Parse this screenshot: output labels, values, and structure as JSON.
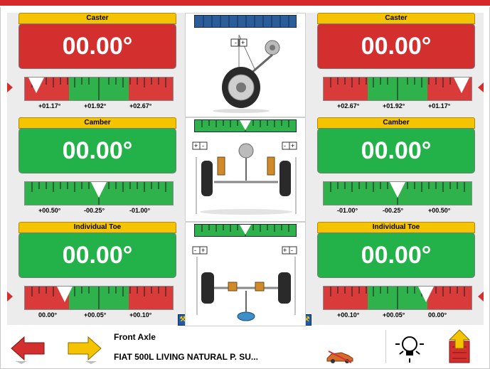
{
  "gauges": {
    "caster_left": {
      "title": "Caster",
      "value": "00.00°",
      "labels": [
        "+01.17°",
        "+01.92°",
        "+02.67°"
      ]
    },
    "caster_right": {
      "title": "Caster",
      "value": "00.00°",
      "labels": [
        "+02.67°",
        "+01.92°",
        "+01.17°"
      ]
    },
    "camber_left": {
      "title": "Camber",
      "value": "00.00°",
      "labels": [
        "+00.50°",
        "-00.25°",
        "-01.00°"
      ]
    },
    "camber_right": {
      "title": "Camber",
      "value": "00.00°",
      "labels": [
        "-01.00°",
        "-00.25°",
        "+00.50°"
      ]
    },
    "toe_left": {
      "title": "Individual Toe",
      "value": "00.00°",
      "labels": [
        "00.00°",
        "+00.05°",
        "+00.10°"
      ]
    },
    "toe_right": {
      "title": "Individual Toe",
      "value": "00.00°",
      "labels": [
        "+00.10°",
        "+00.05°",
        "00.00°"
      ]
    }
  },
  "bottom": {
    "axle": "Front Axle",
    "vehicle": "FIAT 500L LIVING NATURAL P. SU..."
  },
  "colors": {
    "red": "#d42f2f",
    "green": "#23b14a",
    "title_yellow": "#f5c400",
    "gauge_blue": "#2a5d9a"
  },
  "icons": {
    "back": "left-arrow-red-icon",
    "forward": "right-arrow-yellow-icon",
    "light": "light-bulb-icon",
    "exit": "exit-door-icon",
    "car": "car-icon",
    "wrench": "wrench-icon"
  }
}
